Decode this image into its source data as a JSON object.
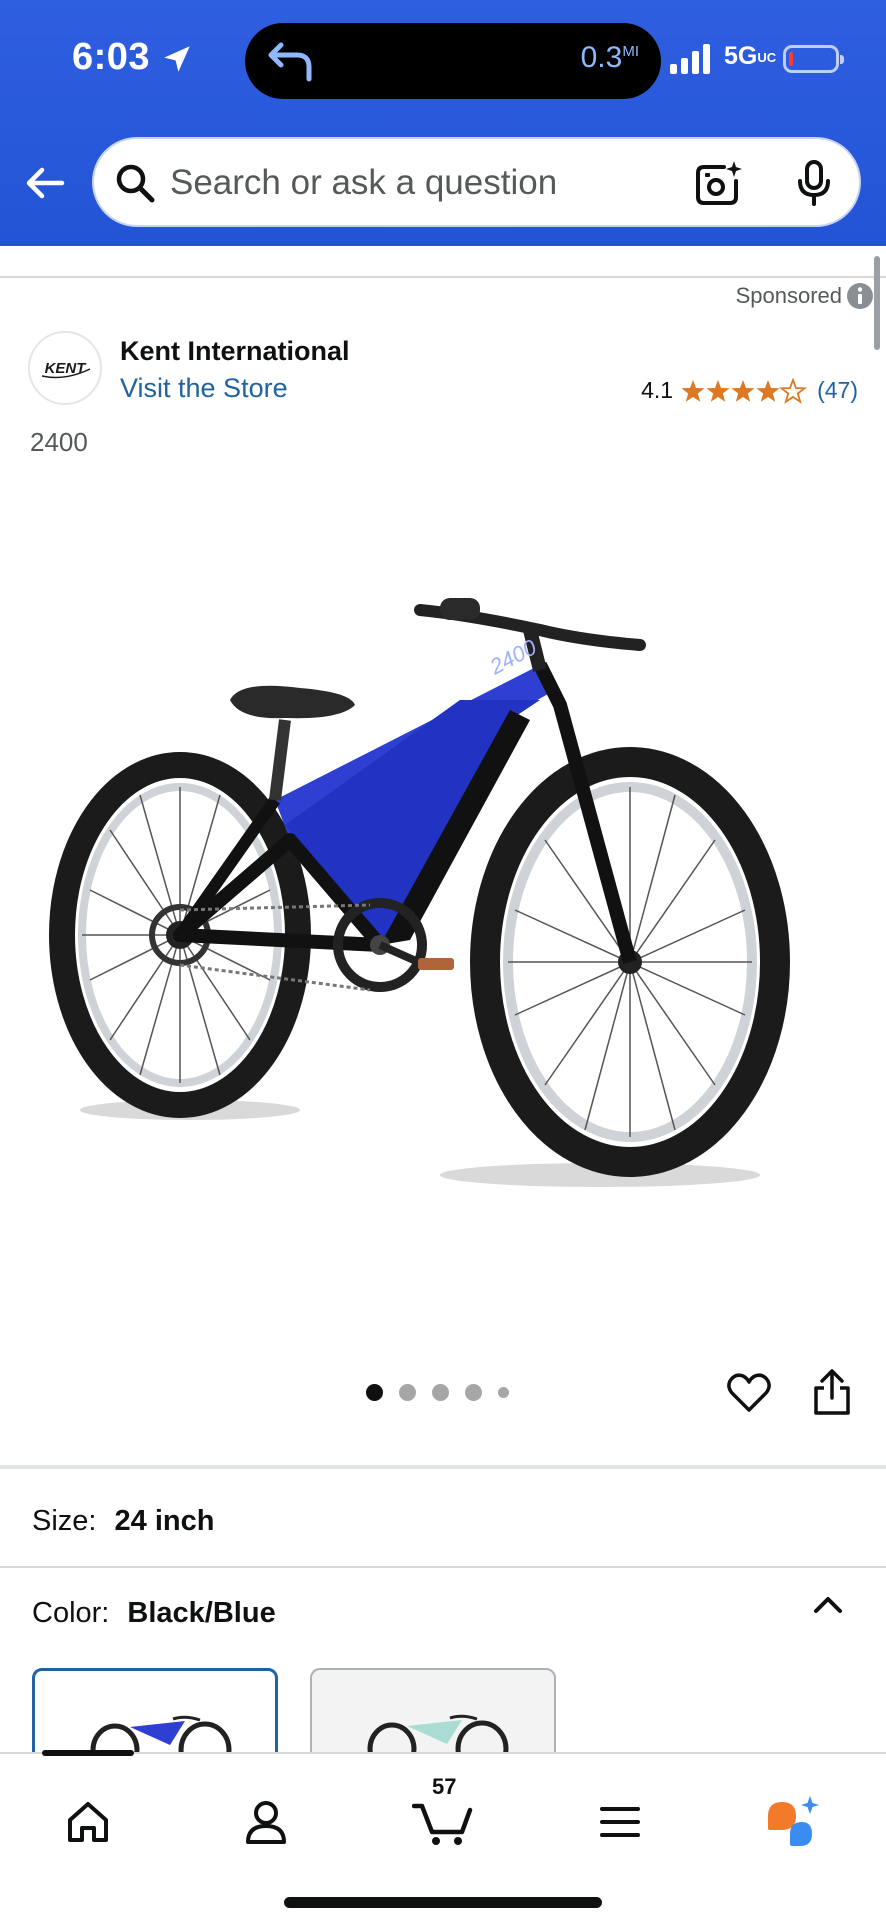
{
  "status_bar": {
    "time": "6:03",
    "navigation_distance": "0.3",
    "distance_unit": "MI",
    "network": "5G",
    "network_suffix": "UC"
  },
  "search": {
    "placeholder": "Search or ask a question"
  },
  "listing": {
    "sponsored_label": "Sponsored",
    "brand_logo_text": "KENT",
    "brand_name": "Kent International",
    "store_link": "Visit the Store",
    "rating": "4.1",
    "rating_value": 4.1,
    "review_count": "(47)",
    "model": "2400",
    "image_count": 5,
    "active_image_index": 0
  },
  "variations": {
    "size_label": "Size:",
    "size_value": "24 inch",
    "color_label": "Color:",
    "color_value": "Black/Blue",
    "swatches": [
      {
        "name": "Black/Blue",
        "selected": true
      },
      {
        "name": "Mint",
        "selected": false
      }
    ]
  },
  "bottom_nav": {
    "items": [
      "home",
      "account",
      "cart",
      "menu",
      "rufus"
    ],
    "cart_count": "57"
  },
  "colors": {
    "header_blue": "#2454d6",
    "link_blue": "#2162a1",
    "star_orange": "#de7921",
    "rufus_orange": "#f27a2a",
    "rufus_blue": "#3b8cf0"
  }
}
